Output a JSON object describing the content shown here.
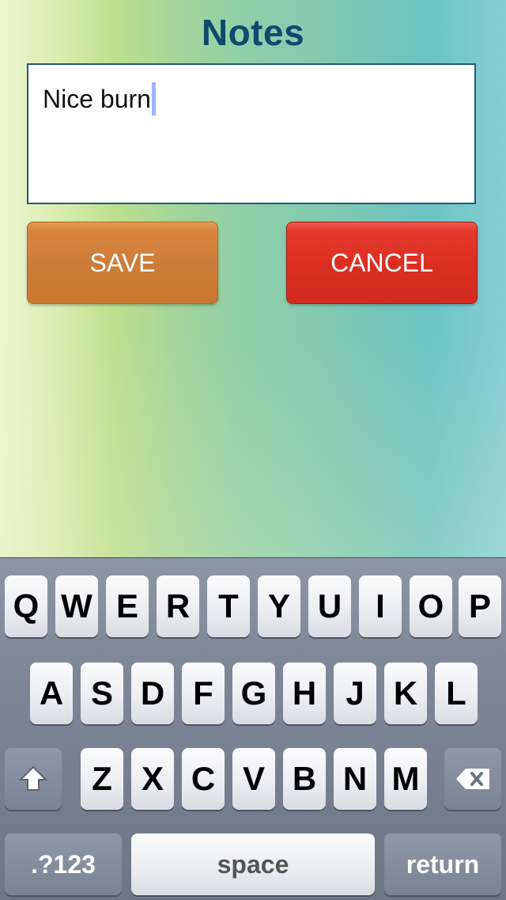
{
  "header": {
    "title": "Notes"
  },
  "notes": {
    "text": "Nice burn"
  },
  "actions": {
    "save_label": "SAVE",
    "cancel_label": "CANCEL"
  },
  "keyboard": {
    "row1": [
      "Q",
      "W",
      "E",
      "R",
      "T",
      "Y",
      "U",
      "I",
      "O",
      "P"
    ],
    "row2": [
      "A",
      "S",
      "D",
      "F",
      "G",
      "H",
      "J",
      "K",
      "L"
    ],
    "row3": [
      "Z",
      "X",
      "C",
      "V",
      "B",
      "N",
      "M"
    ],
    "numbers_label": ".?123",
    "space_label": "space",
    "return_label": "return",
    "shift_icon": "shift-icon",
    "backspace_icon": "backspace-icon"
  },
  "colors": {
    "title": "#0d4a6e",
    "save": "#cd7d3a",
    "cancel": "#dc2f22"
  }
}
